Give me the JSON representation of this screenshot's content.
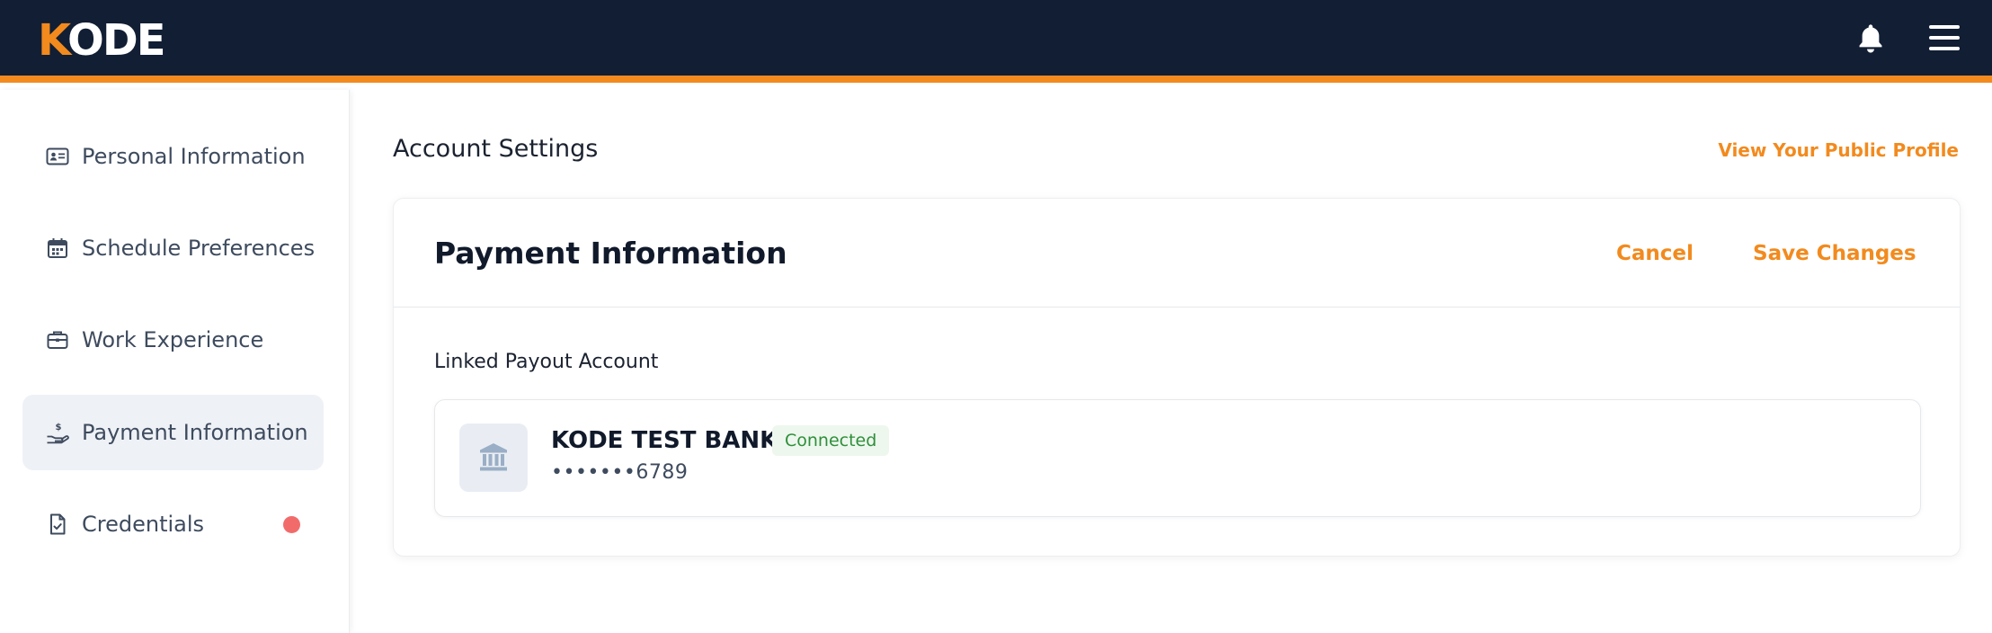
{
  "brand": {
    "logo_first": "K",
    "logo_rest": "ODE"
  },
  "header": {
    "icons": [
      "bell-icon",
      "hamburger-menu-icon"
    ]
  },
  "sidebar": {
    "items": [
      {
        "label": "Personal Information",
        "icon": "id-card-icon",
        "active": false
      },
      {
        "label": "Schedule Preferences",
        "icon": "calendar-icon",
        "active": false
      },
      {
        "label": "Work Experience",
        "icon": "briefcase-icon",
        "active": false
      },
      {
        "label": "Payment Information",
        "icon": "hand-dollar-icon",
        "active": true
      },
      {
        "label": "Credentials",
        "icon": "document-check-icon",
        "active": false,
        "has_alert": true
      }
    ]
  },
  "main": {
    "title": "Account Settings",
    "public_profile_link": "View Your Public Profile"
  },
  "card": {
    "title": "Payment Information",
    "cancel_label": "Cancel",
    "save_label": "Save Changes",
    "section_label": "Linked Payout Account",
    "account": {
      "bank_name": "KODE TEST BANK",
      "status": "Connected",
      "masked_number": "•••••••6789",
      "icon": "bank-icon"
    }
  },
  "colors": {
    "navy": "#111e34",
    "accent_orange": "#f28a1e",
    "active_bg": "#eef1f6",
    "alert_red": "#f26b6b",
    "success_green": "#2f8f3a",
    "success_bg": "#edf7ee"
  }
}
